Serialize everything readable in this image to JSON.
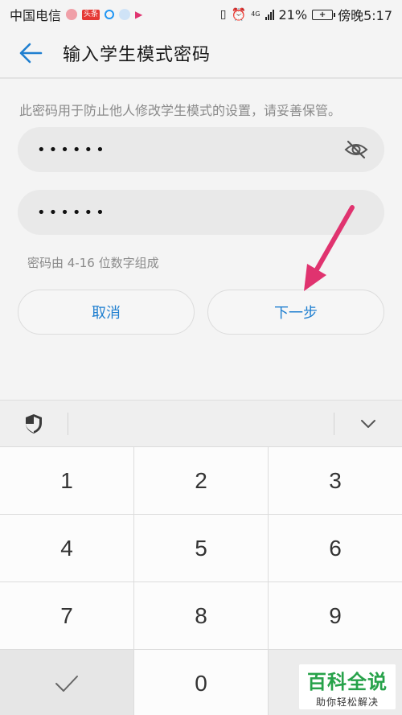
{
  "status_bar": {
    "carrier": "中国电信",
    "news_badge": "头条",
    "network": "4G",
    "battery_percent": "21%",
    "time": "傍晚5:17"
  },
  "header": {
    "title": "输入学生模式密码"
  },
  "form": {
    "hint": "此密码用于防止他人修改学生模式的设置，请妥善保管。",
    "password1_value": "••••••",
    "password2_value": "••••••",
    "rule": "密码由 4-16 位数字组成"
  },
  "buttons": {
    "cancel": "取消",
    "next": "下一步"
  },
  "keypad": {
    "keys": [
      "1",
      "2",
      "3",
      "4",
      "5",
      "6",
      "7",
      "8",
      "9",
      "",
      "0",
      ""
    ]
  },
  "watermark": {
    "title": "百科全说",
    "subtitle": "助你轻松解决"
  },
  "colors": {
    "accent": "#1f7fd0",
    "annotation_arrow": "#e0336f",
    "watermark_green": "#27a24a"
  },
  "icons": {
    "back": "arrow-left-icon",
    "eye": "eye-slash-icon",
    "shield": "shield-icon",
    "collapse": "chevron-down-icon",
    "done": "check-icon"
  }
}
